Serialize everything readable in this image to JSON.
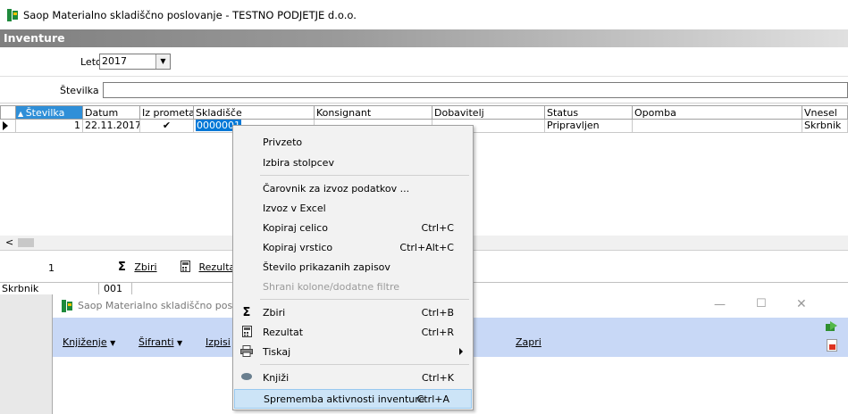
{
  "window": {
    "title": "Saop Materialno skladiščno poslovanje - TESTNO PODJETJE d.o.o."
  },
  "section": {
    "title": "Inventure"
  },
  "filters": {
    "leto_label": "Leto",
    "leto_value": "2017",
    "stevilka_label": "Številka",
    "stevilka_value": ""
  },
  "grid": {
    "columns": [
      "Številka",
      "Datum",
      "Iz prometa",
      "Skladišče",
      "Konsignant",
      "Dobavitelj",
      "Status",
      "Opomba",
      "Vnesel"
    ],
    "row": {
      "stevilka": "1",
      "datum": "22.11.2017",
      "iz_prometa": "✔",
      "skladisce": "0000001",
      "konsignant": "",
      "dobavitelj": "",
      "status": "Pripravljen",
      "opomba": "",
      "vnesel": "Skrbnik"
    }
  },
  "footer": {
    "count": "1",
    "zbiri_label": "Zbiri",
    "rezultat_label": "Rezulta"
  },
  "status_bar": {
    "user": "Skrbnik",
    "code": "001"
  },
  "second_window": {
    "title": "Saop Materialno skladiščno pos",
    "menus": [
      "Knjiženje",
      "Šifranti",
      "Izpisi"
    ],
    "zapri_label": "Zapri"
  },
  "context_menu": {
    "items": [
      {
        "label": "Privzeto",
        "shortcut": ""
      },
      {
        "label": "Izbira stolpcev",
        "shortcut": ""
      },
      {
        "label": "Čarovnik za izvoz podatkov ...",
        "shortcut": ""
      },
      {
        "label": "Izvoz v Excel",
        "shortcut": ""
      },
      {
        "label": "Kopiraj celico",
        "shortcut": "Ctrl+C"
      },
      {
        "label": "Kopiraj vrstico",
        "shortcut": "Ctrl+Alt+C"
      },
      {
        "label": "Število prikazanih zapisov",
        "shortcut": ""
      },
      {
        "label": "Shrani kolone/dodatne filtre",
        "shortcut": ""
      },
      {
        "label": "Zbiri",
        "shortcut": "Ctrl+B"
      },
      {
        "label": "Rezultat",
        "shortcut": "Ctrl+R"
      },
      {
        "label": "Tiskaj",
        "shortcut": ""
      },
      {
        "label": "Knjiži",
        "shortcut": "Ctrl+K"
      },
      {
        "label": "Sprememba aktivnosti inventure",
        "shortcut": "Ctrl+A"
      }
    ]
  },
  "colors": {
    "header_gradient_start": "#7f7f7f",
    "sorted_column": "#2f8fd8",
    "menu_highlight": "#cce4f7",
    "toolbar_bg": "#c8d8f6"
  }
}
